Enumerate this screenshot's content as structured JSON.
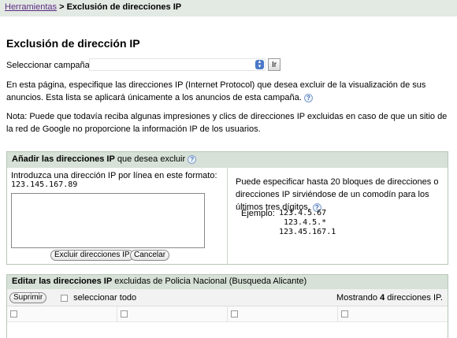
{
  "breadcrumb": {
    "link": "Herramientas",
    "separator": ">",
    "current": "Exclusión de direcciones IP"
  },
  "title": "Exclusión de dirección IP",
  "campaign": {
    "label": "Seleccionar campaña:",
    "go_label": "Ir"
  },
  "intro": "En esta página, especifique las direcciones IP (Internet Protocol) que desea excluir de la visualización de sus anuncios. Esta lista se aplicará únicamente a los anuncios de esta campaña.",
  "note": "Nota: Puede que todavía reciba algunas impresiones y clics de direcciones IP excluidas en caso de que un sitio de la red de Google no proporcione la información IP de los usuarios.",
  "add_panel": {
    "title_bold": "Añadir las direcciones IP",
    "title_rest": " que desea excluir",
    "instruction": "Introduzca una dirección IP por línea en este formato:",
    "format_example": "123.145.167.89",
    "exclude_button": "Excluir direcciones IP",
    "cancel_button": "Cancelar",
    "info": "Puede especificar hasta 20 bloques de direcciones o direcciones IP sirviéndose de un comodín para los últimos tres dígitos.",
    "example_label": "Ejemplo:",
    "example_ips": [
      "123.4.5.67",
      "123.4.5.*",
      "123.45.167.1"
    ]
  },
  "edit_panel": {
    "title_bold": "Editar las direcciones IP",
    "title_rest": " excluidas de Policia Nacional (Busqueda Alicante)",
    "delete_button": "Suprimir",
    "select_all": "seleccionar todo",
    "showing_prefix": "Mostrando ",
    "showing_count": "4",
    "showing_suffix": " direcciones IP."
  },
  "colors": {
    "header_bg": "#d7e1d7",
    "breadcrumb_bg": "#e3e9e3",
    "link": "#5a2a82"
  }
}
